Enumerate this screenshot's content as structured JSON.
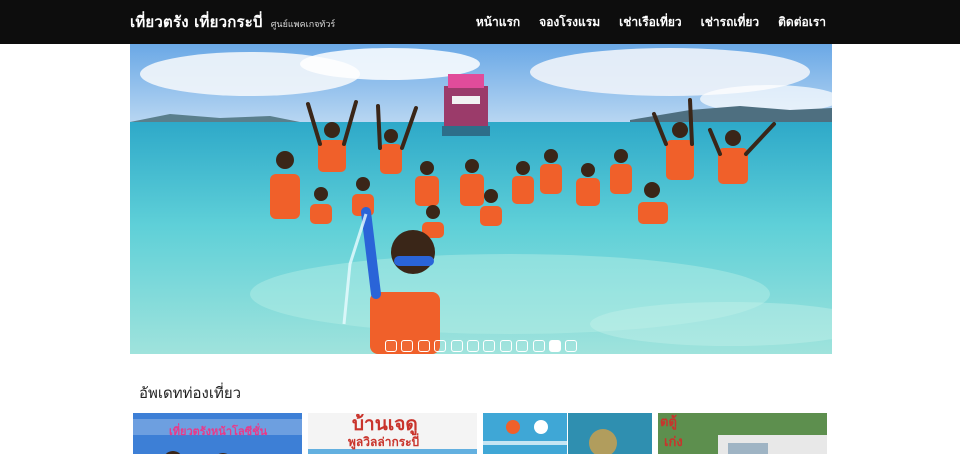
{
  "header": {
    "brand_title": "เที่ยวตรัง เที่ยวกระบี่",
    "brand_sub": "ศูนย์แพคเกจทัวร์",
    "nav": [
      "หน้าแรก",
      "จองโรงแรม",
      "เช่าเรือเที่ยว",
      "เช่ารถเที่ยว",
      "ติดต่อเรา"
    ]
  },
  "carousel": {
    "slide_count": 12,
    "active_index": 10
  },
  "section": {
    "title": "อัพเดทท่องเที่ยว"
  },
  "cards": [
    {
      "caption": "เที่ยวตรังหน้าโลซีชั่น"
    },
    {
      "caption": "บ้านเจดู",
      "caption2": "พูลวิลล่ากระบี่"
    },
    {
      "caption": ""
    },
    {
      "caption": "ตตู้",
      "caption2": "เก่ง"
    }
  ],
  "colors": {
    "navbar": "#0d0d0d",
    "sea": "#4fc3d6",
    "sky": "#7db8e8",
    "lifejacket": "#f0602a",
    "card1_bg": "#3d7fd6",
    "card1_text": "#e83a8a",
    "card2_text": "#c9342c"
  }
}
